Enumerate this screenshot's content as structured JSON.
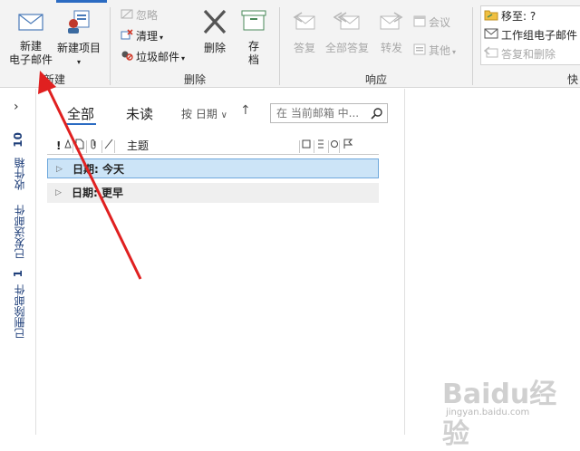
{
  "ribbon": {
    "new_group": {
      "new_email": "新建\n电子邮件",
      "new_item": "新建项目",
      "label": "新建"
    },
    "delete_group": {
      "ignore": "忽略",
      "clean": "清理",
      "junk": "垃圾邮件",
      "delete": "删除",
      "archive": "存\n档",
      "label": "删除"
    },
    "respond_group": {
      "reply": "答复",
      "reply_all": "全部答复",
      "forward": "转发",
      "meeting": "会议",
      "more": "其他",
      "label": "响应"
    },
    "quick_steps": {
      "move_to": "移至: ?",
      "team_email": "工作组电子邮件",
      "reply_delete": "答复和删除",
      "label": "快"
    }
  },
  "folders": {
    "inbox": "收件箱",
    "inbox_count": "10",
    "sent": "已发送邮件",
    "deleted": "已删除邮件",
    "deleted_count": "1"
  },
  "list": {
    "filter_all": "全部",
    "filter_unread": "未读",
    "sort_label": "按 日期",
    "search_placeholder": "在 当前邮箱 中...",
    "col_importance": "!",
    "col_subject": "主题",
    "groups": [
      {
        "label": "日期: 今天"
      },
      {
        "label": "日期: 更早"
      }
    ]
  },
  "watermark": {
    "main": "Baidu经验",
    "sub": "jingyan.baidu.com"
  },
  "colors": {
    "accent": "#2b6bc2",
    "selected_row": "#cce4f7",
    "arrow": "#e02020"
  }
}
